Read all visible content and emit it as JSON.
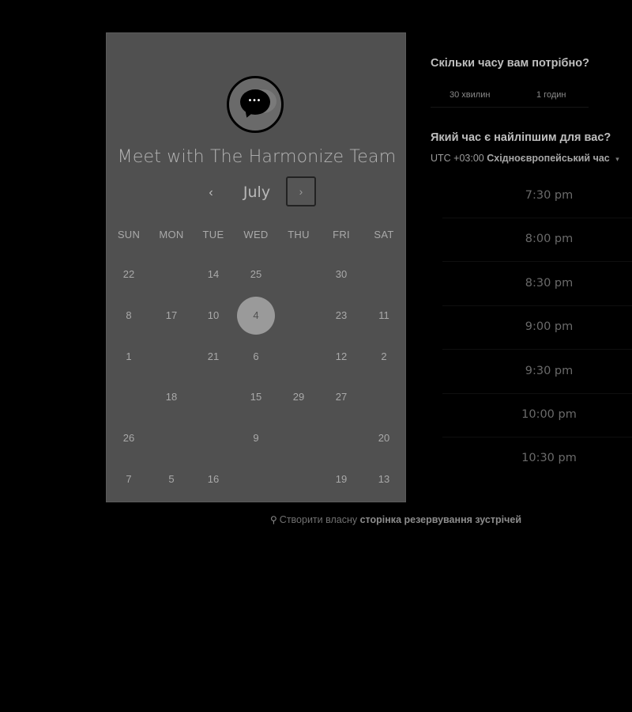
{
  "calendar": {
    "title": "Meet with The Harmonize Team",
    "month": "July",
    "prev_label": "‹",
    "next_label": "›",
    "weekdays": [
      "SUN",
      "MON",
      "TUE",
      "WED",
      "THU",
      "FRI",
      "SAT"
    ],
    "selected_day": "4",
    "rows": [
      [
        "22",
        "",
        "14",
        "25",
        "",
        "30",
        ""
      ],
      [
        "8",
        "17",
        "10",
        "4",
        "",
        "23",
        "11"
      ],
      [
        "1",
        "",
        "21",
        "6",
        "",
        "12",
        "2"
      ],
      [
        "",
        "18",
        "",
        "15",
        "29",
        "27",
        ""
      ],
      [
        "26",
        "",
        "",
        "9",
        "",
        "",
        "20"
      ],
      [
        "7",
        "5",
        "16",
        "",
        "",
        "19",
        "13"
      ]
    ]
  },
  "duration": {
    "heading": "Скільки часу вам потрібно?",
    "options": [
      "30 хвилин",
      "1 годин"
    ]
  },
  "time": {
    "heading": "Який час є найліпшим для вас?",
    "timezone_offset": "UTC +03:00",
    "timezone_name": "Східноєвропейський час",
    "slots": [
      "7:30 pm",
      "8:00 pm",
      "8:30 pm",
      "9:00 pm",
      "9:30 pm",
      "10:00 pm",
      "10:30 pm"
    ]
  },
  "footer": {
    "prefix": "Створити власну",
    "link": "сторінка резервування зустрічей"
  },
  "colors": {
    "page_bg": "#000000",
    "card_bg": "#505050",
    "selected_day_bg": "#9a9a9a"
  }
}
